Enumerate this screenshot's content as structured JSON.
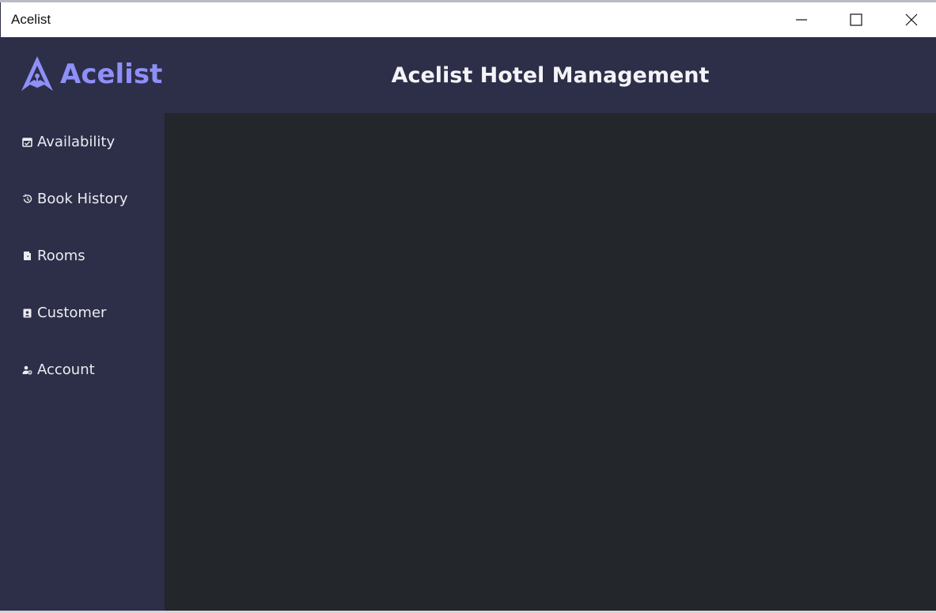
{
  "window": {
    "title": "Acelist"
  },
  "header": {
    "logo_text": "Acelist",
    "app_title": "Acelist Hotel Management"
  },
  "sidebar": {
    "items": [
      {
        "label": "Availability",
        "icon": "calendar-check-icon"
      },
      {
        "label": "Book History",
        "icon": "history-icon"
      },
      {
        "label": "Rooms",
        "icon": "door-icon"
      },
      {
        "label": "Customer",
        "icon": "contact-badge-icon"
      },
      {
        "label": "Account",
        "icon": "user-gear-icon"
      }
    ]
  },
  "colors": {
    "sidebar_bg": "#2d2e48",
    "content_bg": "#23262a",
    "brand": "#8f8ff7",
    "text": "#ececf2"
  }
}
